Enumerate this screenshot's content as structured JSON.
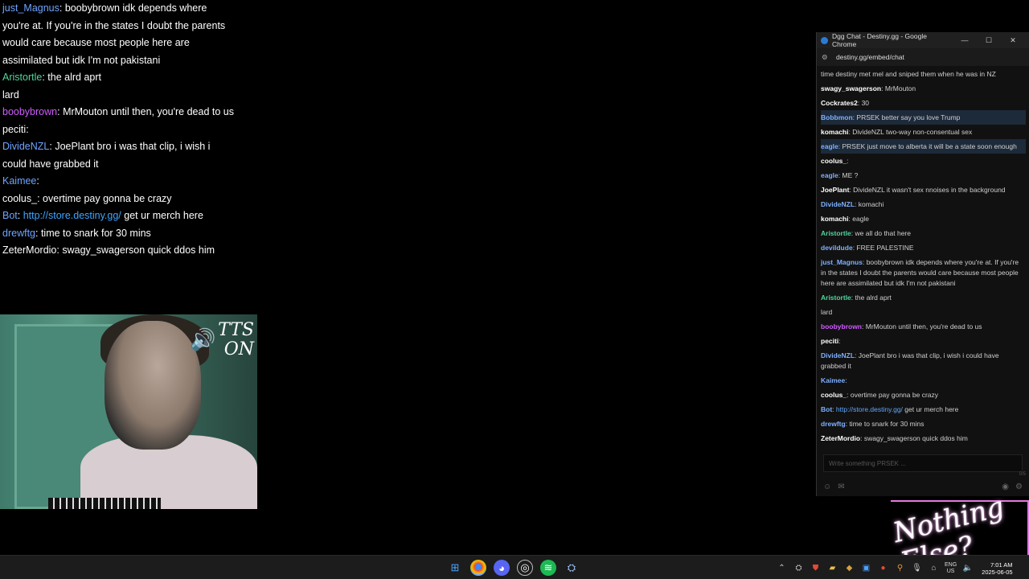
{
  "big_chat": [
    {
      "user": "just_Magnus",
      "color": "#6fa4ff",
      "text": "boobybrown idk depends where you're at. If you're in the states I doubt the parents would care because most people here are assimilated but idk I'm not pakistani"
    },
    {
      "user": "Aristortle",
      "color": "#52d49c",
      "text": "the alrd aprt"
    },
    {
      "user": "",
      "color": "#ffffff",
      "text": "lard"
    },
    {
      "user": "boobybrown",
      "color": "#d05cff",
      "text": "MrMouton until then, you're dead to us"
    },
    {
      "user": "peciti",
      "color": "#ffffff",
      "text": ""
    },
    {
      "user": "DivideNZL",
      "color": "#6fa4ff",
      "text": "JoePlant bro i was that clip, i wish i could have grabbed it"
    },
    {
      "user": "Kaimee",
      "color": "#6fa4ff",
      "text": ""
    },
    {
      "user": "coolus_",
      "color": "#ffffff",
      "text": "overtime pay gonna be crazy"
    },
    {
      "user": "Bot",
      "color": "#6fa4ff",
      "link": "http://store.destiny.gg/",
      "text": "get ur merch here"
    },
    {
      "user": "drewftg",
      "color": "#6fa4ff",
      "text": "time to snark for 30 mins"
    },
    {
      "user": "ZeterMordio",
      "color": "#ffffff",
      "text": "swagy_swagerson quick ddos him"
    }
  ],
  "webcam": {
    "tts_label": "TTS ON"
  },
  "browser": {
    "title": "Dgg Chat - Destiny.gg - Google Chrome",
    "url": "destiny.gg/embed/chat",
    "minimize": "—",
    "maximize": "☐",
    "close": "✕",
    "input_placeholder": "Write something PRSEK ...",
    "counter": "0/5"
  },
  "chat_lines": [
    {
      "user": "",
      "color": "#cfcfcf",
      "text": "time destiny met mel and sniped them when he was in NZ",
      "hl": false
    },
    {
      "user": "swagy_swagerson",
      "color": "#ffffff",
      "text": "MrMouton",
      "hl": false
    },
    {
      "user": "Cockrates2",
      "color": "#ffffff",
      "text": "30",
      "hl": false
    },
    {
      "user": "Bobbmon",
      "color": "#7fb0ff",
      "text": "PRSEK better say you love Trump",
      "hl": true
    },
    {
      "user": "komachi",
      "color": "#ffffff",
      "text": "DivideNZL two-way non-consentual sex",
      "hl": false
    },
    {
      "user": "eagle",
      "color": "#7fb0ff",
      "text": "PRSEK just move to alberta it will be a state soon enough",
      "hl": true
    },
    {
      "user": "coolus_",
      "color": "#ffffff",
      "text": "",
      "hl": false
    },
    {
      "user": "eagle",
      "color": "#7fb0ff",
      "text": "ME ?",
      "hl": false
    },
    {
      "user": "JoePlant",
      "color": "#ffffff",
      "text": "DivideNZL it wasn't sex nnoises in the background",
      "hl": false
    },
    {
      "user": "DivideNZL",
      "color": "#7fb0ff",
      "text": "komachi",
      "hl": false
    },
    {
      "user": "komachi",
      "color": "#ffffff",
      "text": "eagle",
      "hl": false
    },
    {
      "user": "Aristortle",
      "color": "#52d49c",
      "text": "we all do that here",
      "hl": false
    },
    {
      "user": "devildude",
      "color": "#7fb0ff",
      "text": "FREE PALESTINE",
      "hl": false
    },
    {
      "user": "just_Magnus",
      "color": "#7fb0ff",
      "text": "boobybrown idk depends where you're at. If you're in the states I doubt the parents would care because most people here are assimilated but idk I'm not pakistani",
      "hl": false
    },
    {
      "user": "Aristortle",
      "color": "#52d49c",
      "text": "the alrd aprt",
      "hl": false
    },
    {
      "user": "",
      "color": "#cfcfcf",
      "text": "lard",
      "hl": false
    },
    {
      "user": "boobybrown",
      "color": "#d05cff",
      "text": "MrMouton until then, you're dead to us",
      "hl": false
    },
    {
      "user": "peciti",
      "color": "#ffffff",
      "text": "",
      "hl": false
    },
    {
      "user": "DivideNZL",
      "color": "#7fb0ff",
      "text": "JoePlant bro i was that clip, i wish i could have grabbed it",
      "hl": false
    },
    {
      "user": "Kaimee",
      "color": "#7fb0ff",
      "text": "",
      "hl": false
    },
    {
      "user": "coolus_",
      "color": "#ffffff",
      "text": "overtime pay gonna be crazy",
      "hl": false
    },
    {
      "user": "Bot",
      "color": "#7fb0ff",
      "link": "http://store.destiny.gg/",
      "text": "get ur merch here",
      "hl": false
    },
    {
      "user": "drewftg",
      "color": "#7fb0ff",
      "text": "time to snark for 30 mins",
      "hl": false
    },
    {
      "user": "ZeterMordio",
      "color": "#ffffff",
      "text": "swagy_swagerson quick ddos him",
      "hl": false
    }
  ],
  "logo": {
    "text": "Nothing Else?"
  },
  "taskbar": {
    "apps": [
      "windows-start-icon",
      "chrome-icon",
      "discord-icon",
      "obs-icon",
      "spotify-icon",
      "steam-icon"
    ],
    "lang": "ENG",
    "region": "US",
    "time": "7:01 AM",
    "date": "2025-06-05"
  }
}
